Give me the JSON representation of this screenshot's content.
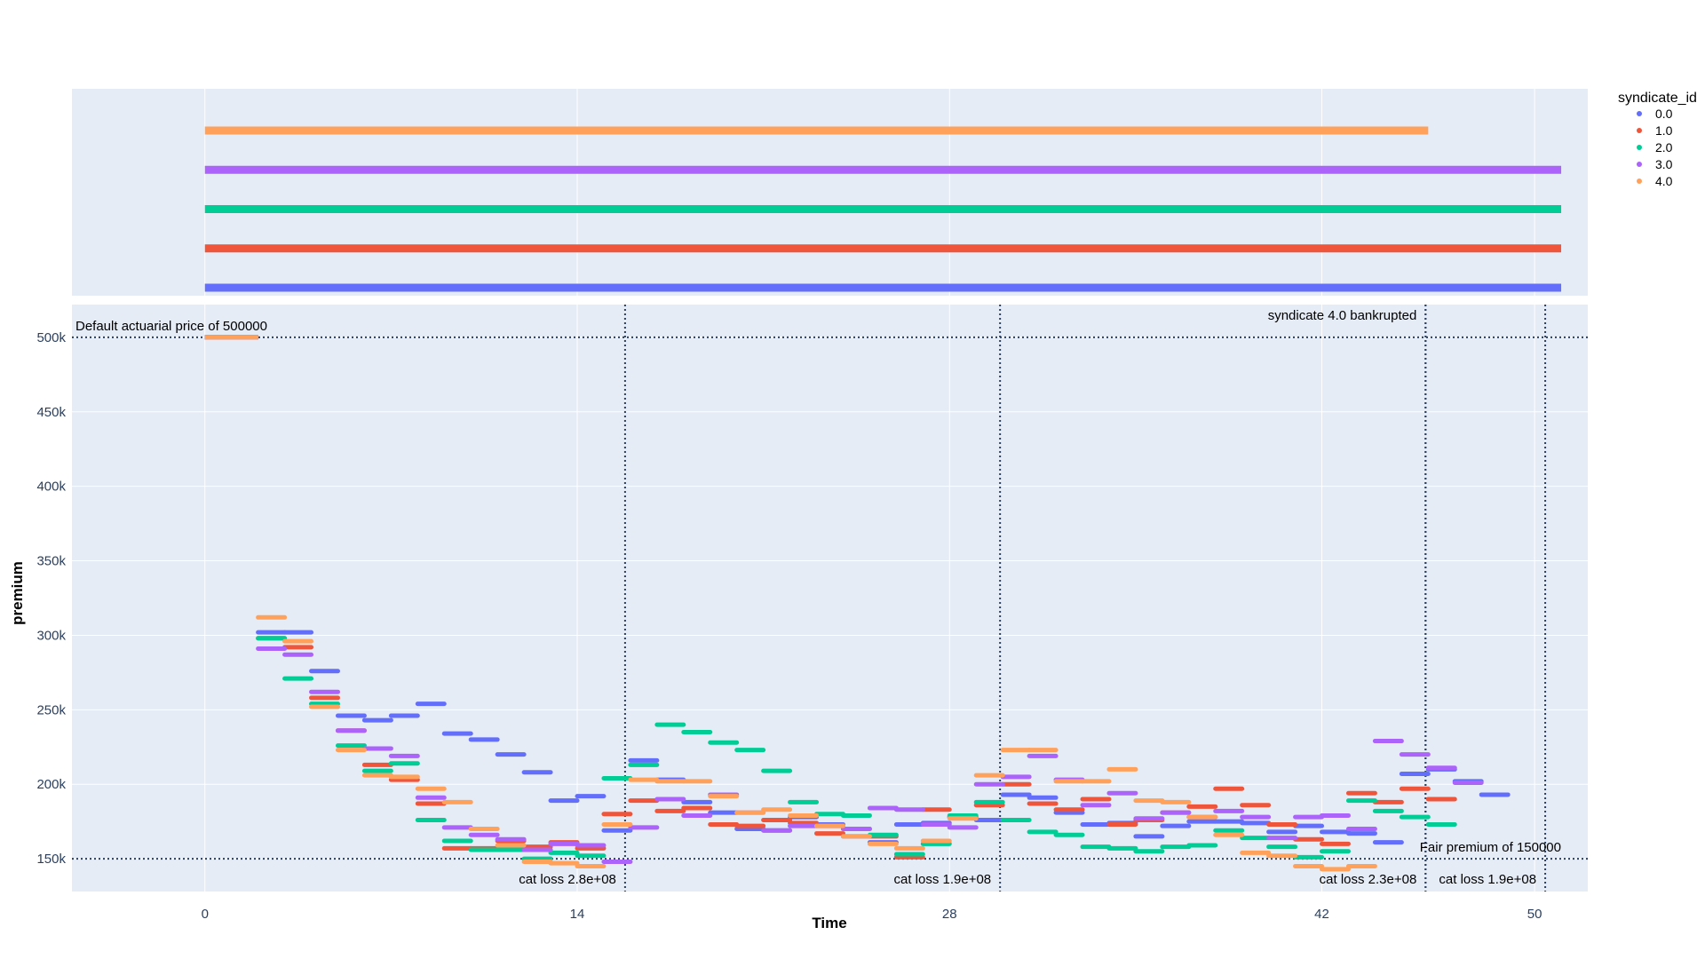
{
  "chart_data": {
    "type": "line",
    "xlabel": "Time",
    "ylabel": "premium",
    "xlim": [
      -5,
      52
    ],
    "ylim": [
      128000,
      522000
    ],
    "x_ticks": [
      0,
      14,
      28,
      42,
      50
    ],
    "y_ticks": [
      {
        "value": 150000,
        "label": "150k"
      },
      {
        "value": 200000,
        "label": "200k"
      },
      {
        "value": 250000,
        "label": "250k"
      },
      {
        "value": 300000,
        "label": "300k"
      },
      {
        "value": 350000,
        "label": "350k"
      },
      {
        "value": 400000,
        "label": "400k"
      },
      {
        "value": 450000,
        "label": "450k"
      },
      {
        "value": 500000,
        "label": "500k"
      }
    ],
    "grid": true,
    "legend": {
      "title": "syndicate_id",
      "placement": "right",
      "entries": [
        "0.0",
        "1.0",
        "2.0",
        "3.0",
        "4.0"
      ]
    },
    "top_panel": {
      "type": "timeline",
      "rows": [
        {
          "syndicate": "0.0",
          "start": 0,
          "end": 51
        },
        {
          "syndicate": "1.0",
          "start": 0,
          "end": 51
        },
        {
          "syndicate": "2.0",
          "start": 0,
          "end": 51
        },
        {
          "syndicate": "3.0",
          "start": 0,
          "end": 51
        },
        {
          "syndicate": "4.0",
          "start": 0,
          "end": 46
        }
      ]
    },
    "hlines": [
      {
        "y": 500000,
        "label": "Default actuarial price of 500000",
        "label_pos": "top-left"
      },
      {
        "y": 150000,
        "label": "Fair premium of 150000",
        "label_pos": "top-right"
      }
    ],
    "vlines": [
      {
        "x": 15.8,
        "label": "cat loss 2.8e+08",
        "label_pos": "bottom-left"
      },
      {
        "x": 29.9,
        "label": "cat loss 1.9e+08",
        "label_pos": "bottom-left"
      },
      {
        "x": 45.9,
        "label": "cat loss 2.3e+08",
        "label_pos": "bottom-left"
      },
      {
        "x": 45.9,
        "label": "syndicate 4.0 bankrupted",
        "label_pos": "top-left"
      },
      {
        "x": 50.4,
        "label": "cat loss 1.9e+08",
        "label_pos": "bottom-left"
      }
    ],
    "x_start": 2,
    "step": 1,
    "seg_width": 1,
    "series": [
      {
        "name": "0.0",
        "color": "#636efa",
        "initial": {
          "x": 0,
          "width": 2,
          "value": 500000
        },
        "values": [
          302000,
          302000,
          276000,
          246000,
          243000,
          246000,
          254000,
          234000,
          230000,
          220000,
          208000,
          189000,
          192000,
          169000,
          216000,
          203000,
          188000,
          181000,
          170000,
          169000,
          178000,
          173000,
          165000,
          161000,
          173000,
          174000,
          178000,
          176000,
          193000,
          191000,
          181000,
          173000,
          174000,
          165000,
          172000,
          175000,
          175000,
          174000,
          168000,
          172000,
          168000,
          167000,
          161000,
          207000,
          210000,
          202000,
          193000
        ]
      },
      {
        "name": "1.0",
        "color": "#ef553b",
        "initial": {
          "x": 0,
          "width": 2,
          "value": 500000
        },
        "values": [
          298000,
          292000,
          258000,
          236000,
          213000,
          203000,
          187000,
          157000,
          157000,
          162000,
          158000,
          161000,
          157000,
          180000,
          189000,
          182000,
          184000,
          173000,
          172000,
          176000,
          174000,
          167000,
          170000,
          165000,
          151000,
          183000,
          178000,
          186000,
          200000,
          187000,
          183000,
          190000,
          173000,
          176000,
          181000,
          185000,
          197000,
          186000,
          173000,
          163000,
          160000,
          194000,
          188000,
          197000,
          190000
        ]
      },
      {
        "name": "2.0",
        "color": "#00cc96",
        "initial": {
          "x": 0,
          "width": 2,
          "value": 500000
        },
        "values": [
          298000,
          271000,
          254000,
          226000,
          209000,
          214000,
          176000,
          162000,
          156000,
          156000,
          150000,
          154000,
          152000,
          204000,
          213000,
          240000,
          235000,
          228000,
          223000,
          209000,
          188000,
          180000,
          179000,
          166000,
          153000,
          160000,
          179000,
          188000,
          176000,
          168000,
          166000,
          158000,
          157000,
          155000,
          158000,
          159000,
          169000,
          164000,
          158000,
          151000,
          155000,
          189000,
          182000,
          178000,
          173000
        ]
      },
      {
        "name": "3.0",
        "color": "#ab63fa",
        "initial": {
          "x": 0,
          "width": 2,
          "value": 500000
        },
        "values": [
          291000,
          287000,
          262000,
          236000,
          224000,
          219000,
          191000,
          171000,
          166000,
          163000,
          156000,
          160000,
          159000,
          148000,
          171000,
          190000,
          179000,
          193000,
          181000,
          169000,
          172000,
          172000,
          170000,
          184000,
          183000,
          173000,
          171000,
          200000,
          205000,
          219000,
          203000,
          186000,
          194000,
          177000,
          181000,
          178000,
          182000,
          178000,
          164000,
          178000,
          179000,
          170000,
          229000,
          220000,
          211000,
          201000
        ]
      },
      {
        "name": "4.0",
        "color": "#ffa15a",
        "initial": {
          "x": 0,
          "width": 2,
          "value": 500000
        },
        "values": [
          312000,
          296000,
          252000,
          223000,
          206000,
          205000,
          197000,
          188000,
          170000,
          159000,
          148000,
          147000,
          145000,
          173000,
          203000,
          202000,
          202000,
          192000,
          181000,
          183000,
          179000,
          172000,
          165000,
          160000,
          157000,
          162000,
          177000,
          206000,
          223000,
          223000,
          202000,
          202000,
          210000,
          189000,
          188000,
          178000,
          166000,
          154000,
          152000,
          145000,
          143000,
          145000
        ]
      }
    ]
  }
}
